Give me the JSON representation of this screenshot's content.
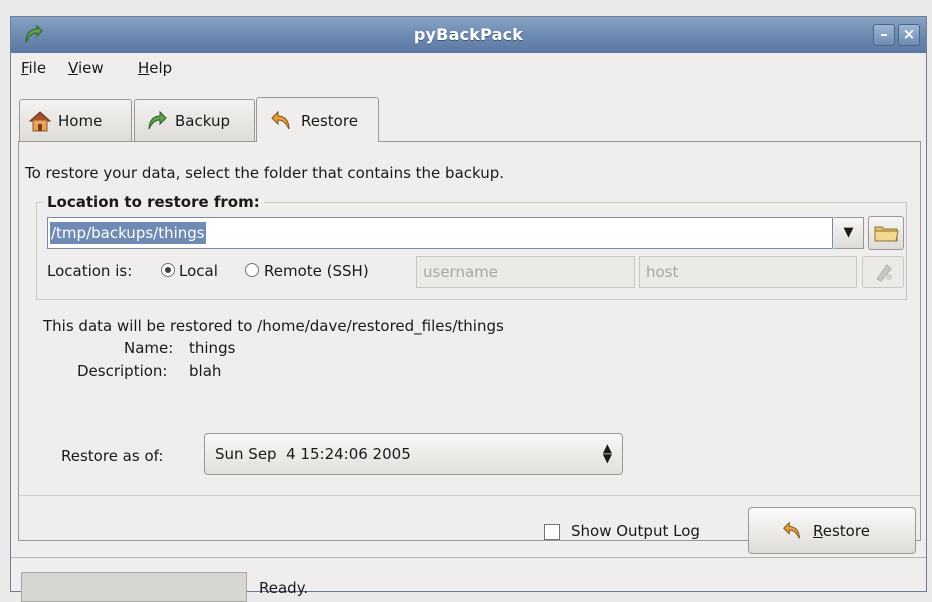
{
  "window": {
    "title": "pyBackPack"
  },
  "menu": {
    "file": "File",
    "view": "View",
    "help": "Help"
  },
  "tabs": [
    {
      "label": "Home",
      "icon": "home-icon"
    },
    {
      "label": "Backup",
      "icon": "backup-arrow-icon"
    },
    {
      "label": "Restore",
      "icon": "restore-arrow-icon",
      "active": true
    }
  ],
  "restore": {
    "instructions": "To restore your data, select the folder that contains the backup.",
    "location_frame_title": "Location to restore from:",
    "location_value": "/tmp/backups/things",
    "location_is_label": "Location is:",
    "radio_local": "Local",
    "radio_remote": "Remote (SSH)",
    "selected_location_type": "Local",
    "username_placeholder": "username",
    "host_placeholder": "host",
    "target_text": "This data will be restored to /home/dave/restored_files/things",
    "name_label": "Name:",
    "name_value": "things",
    "description_label": "Description:",
    "description_value": "blah",
    "restore_as_of_label": "Restore as of:",
    "restore_as_of_value": "Sun Sep  4 15:24:06 2005",
    "show_output_log_label": "Show Output Log",
    "show_output_log_checked": false,
    "restore_button_label": "Restore"
  },
  "status": {
    "text": "Ready.",
    "progress": 0
  },
  "colors": {
    "titlebar": "#6f8cb2",
    "selection": "#6f8ab3",
    "background": "#efeeec"
  }
}
